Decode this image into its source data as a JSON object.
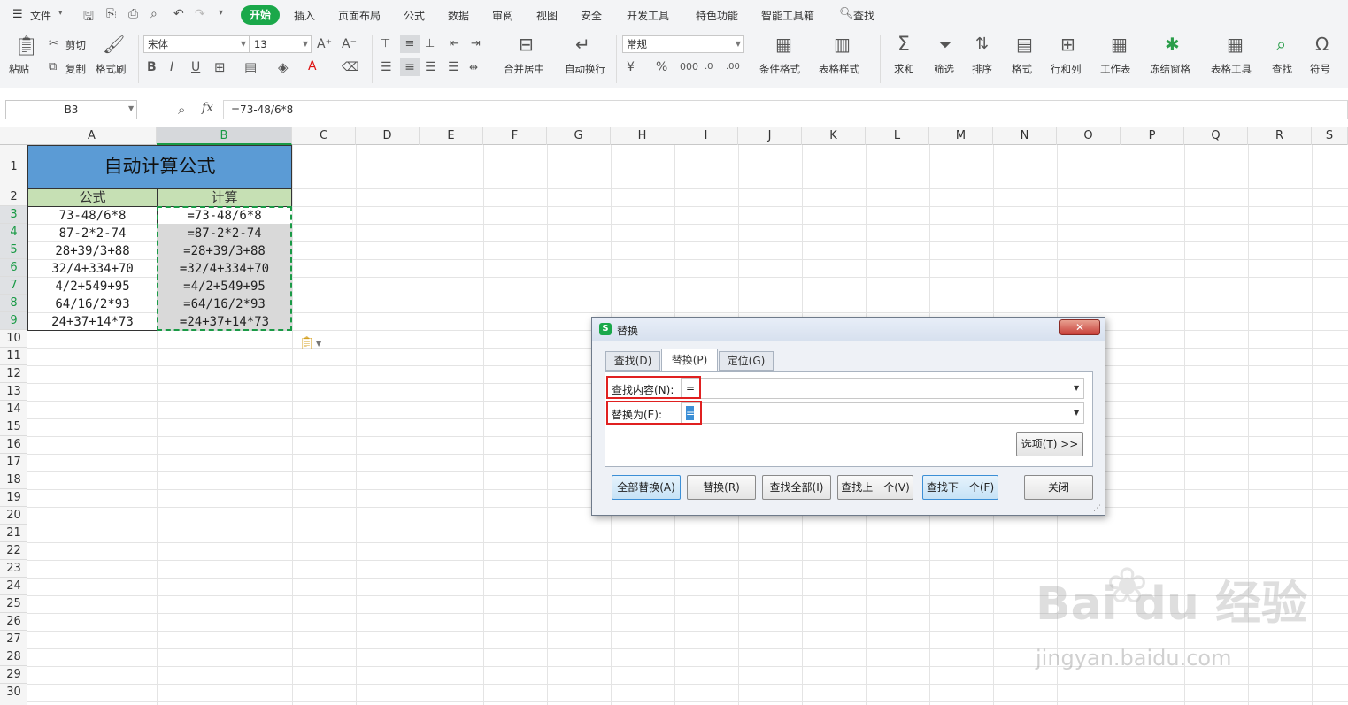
{
  "menubar": {
    "file": "文件",
    "tabs": [
      "开始",
      "插入",
      "页面布局",
      "公式",
      "数据",
      "审阅",
      "视图",
      "安全",
      "开发工具",
      "特色功能",
      "智能工具箱"
    ],
    "search": "查找"
  },
  "ribbon": {
    "paste": "粘贴",
    "cut": "剪切",
    "copy": "复制",
    "format_painter": "格式刷",
    "font_name": "宋体",
    "font_size": "13",
    "merge_center": "合并居中",
    "wrap_text": "自动换行",
    "number_format": "常规",
    "conditional_format": "条件格式",
    "table_style": "表格样式",
    "sum": "求和",
    "filter": "筛选",
    "sort": "排序",
    "format": "格式",
    "rows_cols": "行和列",
    "worksheet": "工作表",
    "freeze": "冻结窗格",
    "table_tools": "表格工具",
    "find": "查找",
    "symbol": "符号"
  },
  "formula_bar": {
    "cell_ref": "B3",
    "fx": "fx",
    "formula": "=73-48/6*8"
  },
  "columns": [
    "A",
    "B",
    "C",
    "D",
    "E",
    "F",
    "G",
    "H",
    "I",
    "J",
    "K",
    "L",
    "M",
    "N",
    "O",
    "P",
    "Q",
    "R",
    "S"
  ],
  "rows": [
    "1",
    "2",
    "3",
    "4",
    "5",
    "6",
    "7",
    "8",
    "9",
    "10",
    "11",
    "12",
    "13",
    "14",
    "15",
    "16",
    "17",
    "18",
    "19",
    "20",
    "21",
    "22",
    "23",
    "24",
    "25",
    "26",
    "27",
    "28",
    "29",
    "30"
  ],
  "sheet": {
    "title": "自动计算公式",
    "header_a": "公式",
    "header_b": "计算",
    "data": [
      {
        "a": "73-48/6*8",
        "b": "=73-48/6*8"
      },
      {
        "a": "87-2*2-74",
        "b": "=87-2*2-74"
      },
      {
        "a": "28+39/3+88",
        "b": "=28+39/3+88"
      },
      {
        "a": "32/4+334+70",
        "b": "=32/4+334+70"
      },
      {
        "a": "4/2+549+95",
        "b": "=4/2+549+95"
      },
      {
        "a": "64/16/2*93",
        "b": "=64/16/2*93"
      },
      {
        "a": "24+37+14*73",
        "b": "=24+37+14*73"
      }
    ]
  },
  "dialog": {
    "title": "替换",
    "tabs": [
      "查找(D)",
      "替换(P)",
      "定位(G)"
    ],
    "find_label": "查找内容(N):",
    "find_value": "=",
    "replace_label": "替换为(E):",
    "replace_value": "=",
    "options": "选项(T) >>",
    "buttons": [
      "全部替换(A)",
      "替换(R)",
      "查找全部(I)",
      "查找上一个(V)",
      "查找下一个(F)",
      "关闭"
    ]
  },
  "watermark": {
    "brand": "Bai du 经验",
    "url": "jingyan.baidu.com"
  },
  "colors": {
    "accent_green": "#1aa84a",
    "title_fill": "#5b9bd5",
    "header_fill": "#c6e0b4",
    "highlight_red": "#e02020"
  }
}
